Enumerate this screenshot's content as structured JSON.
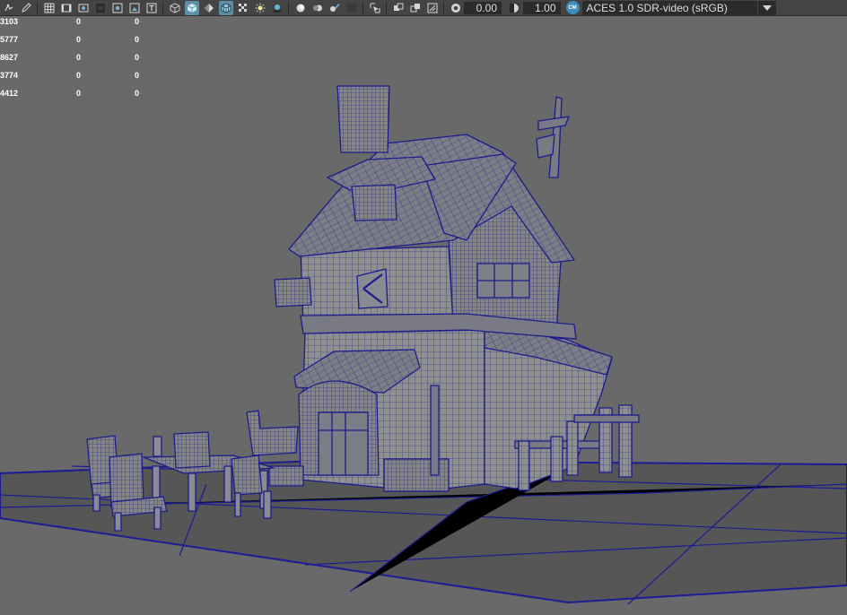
{
  "toolbar": {
    "icons_group1": [
      "select-camera-icon",
      "pencil-icon"
    ],
    "icons_group2": [
      "grid-icon",
      "film-gate-icon",
      "resolution-gate-icon",
      "gate-mask-icon",
      "field-chart-icon",
      "safe-action-icon",
      "safe-title-icon"
    ],
    "icons_group3": [
      "wireframe-cube-icon",
      "smooth-shade-icon",
      "default-material-icon",
      "wireframe-on-shaded-icon",
      "textured-icon",
      "use-all-lights-icon",
      "shadows-icon"
    ],
    "icons_group4": [
      "screen-space-ao-icon",
      "motion-blur-icon",
      "anti-aliasing-icon",
      "depth-of-field-icon"
    ],
    "icons_group5": [
      "isolate-select-icon",
      "xray-icon",
      "xray-joints-icon",
      "xray-components-icon"
    ],
    "exposure_value": "0.00",
    "gamma_value": "1.00",
    "color_badge": "CM",
    "color_space": "ACES 1.0 SDR-video (sRGB)"
  },
  "hud": {
    "rows": [
      [
        "3103",
        "0",
        "0"
      ],
      [
        "5777",
        "0",
        "0"
      ],
      [
        "8627",
        "0",
        "0"
      ],
      [
        "3774",
        "0",
        "0"
      ],
      [
        "4412",
        "0",
        "0"
      ]
    ]
  },
  "colors": {
    "background": "#696969",
    "toolbar": "#444444",
    "wireframe": "#1f1f8c",
    "mesh_fill": "#8d8d8d",
    "ground": "#565656",
    "active_toggle": "#5a8fa8"
  }
}
